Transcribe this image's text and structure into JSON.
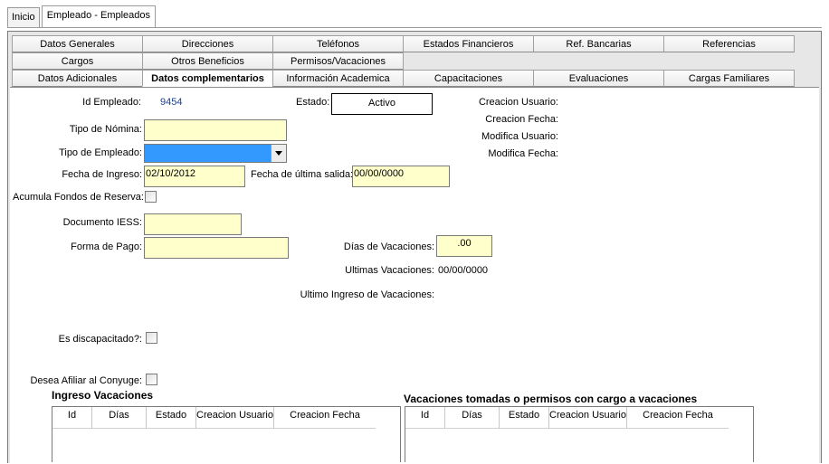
{
  "top_tabs": [
    "Inicio",
    "Empleado - Empleados"
  ],
  "tabs": {
    "row1": [
      "Datos Generales",
      "Direcciones",
      "Teléfonos",
      "Estados Financieros",
      "Ref. Bancarias",
      "Referencias"
    ],
    "row2": [
      "Cargos",
      "Otros Beneficios",
      "Permisos/Vacaciones"
    ],
    "row3": [
      "Datos Adicionales",
      "Datos complementarios",
      "Información Academica",
      "Capacitaciones",
      "Evaluaciones",
      "Cargas Familiares"
    ]
  },
  "form": {
    "id_empleado_label": "Id Empleado:",
    "id_empleado_value": "9454",
    "estado_label": "Estado:",
    "estado_value": "Activo",
    "creacion_usuario_label": "Creacion Usuario:",
    "creacion_fecha_label": "Creacion Fecha:",
    "modifica_usuario_label": "Modifica Usuario:",
    "modifica_fecha_label": "Modifica Fecha:",
    "tipo_nomina_label": "Tipo de Nómina:",
    "tipo_nomina_value": "",
    "tipo_empleado_label": "Tipo de Empleado:",
    "fecha_ingreso_label": "Fecha de Ingreso:",
    "fecha_ingreso_value": "02/10/2012",
    "fecha_ultima_salida_label": "Fecha de última salida:",
    "fecha_ultima_salida_value": "00/00/0000",
    "acumula_fondos_label": "Acumula Fondos de Reserva:",
    "documento_iess_label": "Documento IESS:",
    "documento_iess_value": "",
    "forma_pago_label": "Forma de Pago:",
    "forma_pago_value": "",
    "dias_vacaciones_label": "Días de Vacaciones:",
    "dias_vacaciones_value": ".00",
    "ultimas_vacaciones_label": "Ultimas Vacaciones:",
    "ultimas_vacaciones_value": "00/00/0000",
    "ultimo_ingreso_vac_label": "Ultimo Ingreso de Vacaciones:",
    "es_discapacitado_label": "Es discapacitado?:",
    "desea_afiliar_label": "Desea Afiliar al Conyuge:"
  },
  "ingreso_vacaciones": {
    "title": "Ingreso Vacaciones",
    "columns": [
      "Id",
      "Días",
      "Estado",
      "Creacion Usuario",
      "Creacion Fecha"
    ]
  },
  "vacaciones_tomadas": {
    "title": "Vacaciones tomadas o permisos con cargo a vacaciones",
    "columns": [
      "Id",
      "Días",
      "Estado",
      "Creacion Usuario",
      "Creacion Fecha"
    ]
  },
  "colors": {
    "field_yellow": "#ffffcc",
    "select_blue": "#3399ff",
    "id_value_blue": "#1f3f8f"
  }
}
